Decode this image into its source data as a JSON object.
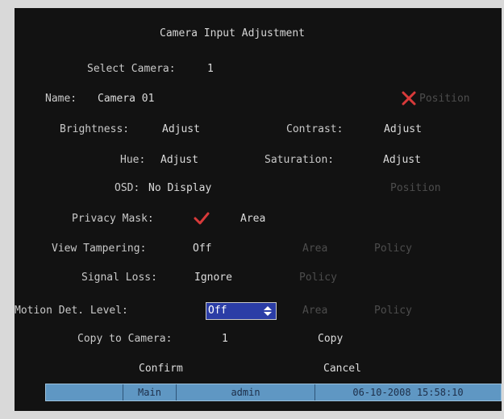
{
  "title": "Camera Input Adjustment",
  "select_camera": {
    "label": "Select Camera:",
    "value": "1"
  },
  "name": {
    "label": "Name:",
    "value": "Camera 01",
    "position_label": "Position"
  },
  "brightness": {
    "label": "Brightness:",
    "value": "Adjust"
  },
  "contrast": {
    "label": "Contrast:",
    "value": "Adjust"
  },
  "hue": {
    "label": "Hue:",
    "value": "Adjust"
  },
  "saturation": {
    "label": "Saturation:",
    "value": "Adjust"
  },
  "osd": {
    "label": "OSD:",
    "value": "No Display",
    "position_label": "Position"
  },
  "privacy_mask": {
    "label": "Privacy Mask:",
    "checked": true,
    "area_label": "Area"
  },
  "view_tampering": {
    "label": "View Tampering:",
    "value": "Off",
    "area_label": "Area",
    "policy_label": "Policy"
  },
  "signal_loss": {
    "label": "Signal Loss:",
    "value": "Ignore",
    "policy_label": "Policy"
  },
  "motion_det": {
    "label": "Motion Det. Level:",
    "value": "Off",
    "area_label": "Area",
    "policy_label": "Policy"
  },
  "copy_to": {
    "label": "Copy to Camera:",
    "value": "1",
    "copy_label": "Copy"
  },
  "buttons": {
    "confirm": "Confirm",
    "cancel": "Cancel"
  },
  "status_bar": {
    "blank": "",
    "menu": "Main",
    "user": "admin",
    "datetime": "06-10-2008 15:58:10"
  },
  "colors": {
    "screen_bg": "#121212",
    "text": "#d6d6d6",
    "disabled_text": "#4d4d4d",
    "check_red": "#d83a3a",
    "combo_bg": "#2b3da6",
    "status_bar_bg": "#5f97c3"
  },
  "icons": {
    "name_mark": "x-mark-icon",
    "privacy_mark": "checkmark-icon",
    "spin": "spin-arrows-icon"
  }
}
